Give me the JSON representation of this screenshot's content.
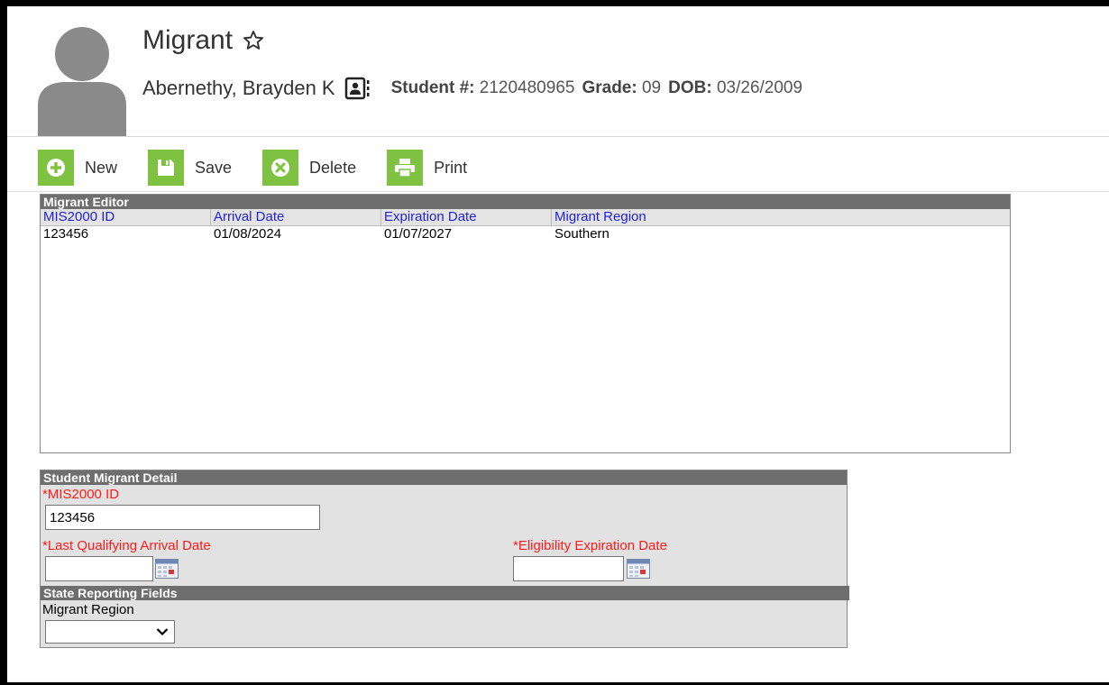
{
  "header": {
    "title": "Migrant",
    "student_name": "Abernethy, Brayden K",
    "student_num_label": "Student #:",
    "student_num": "2120480965",
    "grade_label": "Grade:",
    "grade": "09",
    "dob_label": "DOB:",
    "dob": "03/26/2009"
  },
  "toolbar": {
    "new_label": "New",
    "save_label": "Save",
    "delete_label": "Delete",
    "print_label": "Print"
  },
  "editor": {
    "title": "Migrant Editor",
    "columns": [
      "MIS2000 ID",
      "Arrival Date",
      "Expiration Date",
      "Migrant Region"
    ],
    "rows": [
      [
        "123456",
        "01/08/2024",
        "01/07/2027",
        "Southern"
      ]
    ]
  },
  "detail": {
    "title": "Student Migrant Detail",
    "mis_label": "*MIS2000 ID",
    "mis_value": "123456",
    "arrival_label": "*Last Qualifying Arrival Date",
    "arrival_value": "",
    "expiration_label": "*Eligibility Expiration Date",
    "expiration_value": "",
    "state_title": "State Reporting Fields",
    "region_label": "Migrant Region",
    "region_value": ""
  },
  "colors": {
    "accent_green": "#7fc242",
    "panel_header": "#6e6e6e",
    "link_blue": "#1f1fde",
    "required_red": "#ff1a1a"
  }
}
